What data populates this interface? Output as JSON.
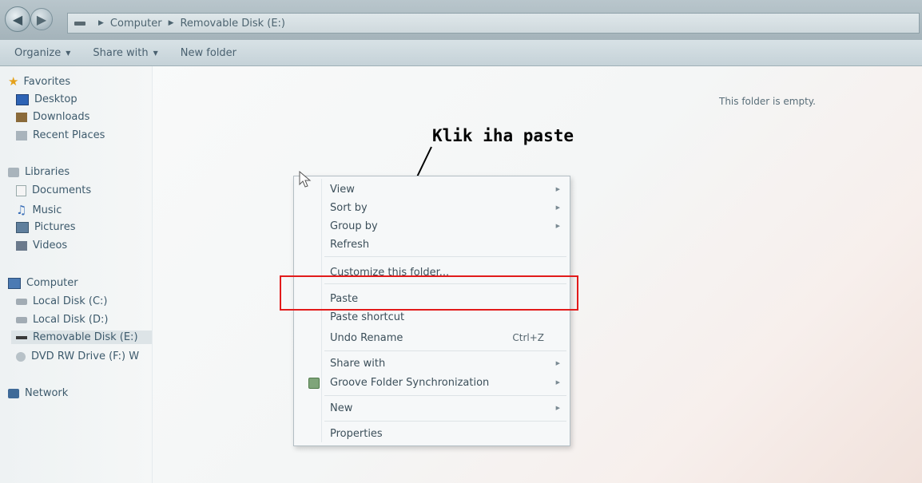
{
  "address_bar": {
    "breadcrumb": [
      "Computer",
      "Removable Disk (E:)"
    ]
  },
  "toolbar": {
    "organize_label": "Organize",
    "share_with_label": "Share with",
    "new_folder_label": "New folder"
  },
  "nav_pane": {
    "items": [
      {
        "label": "Favorites",
        "icon": "star-icon"
      },
      {
        "label": "Desktop",
        "icon": "desktop-icon"
      },
      {
        "label": "Downloads",
        "icon": "downloads-icon"
      },
      {
        "label": "Recent Places",
        "icon": "recent-places-icon"
      },
      {
        "label": "Libraries",
        "icon": "libraries-icon"
      },
      {
        "label": "Documents",
        "icon": "documents-icon"
      },
      {
        "label": "Music",
        "icon": "music-icon"
      },
      {
        "label": "Pictures",
        "icon": "pictures-icon"
      },
      {
        "label": "Videos",
        "icon": "videos-icon"
      },
      {
        "label": "Computer",
        "icon": "computer-icon"
      },
      {
        "label": "Local Disk (C:)",
        "icon": "disk-icon"
      },
      {
        "label": "Local Disk (D:)",
        "icon": "disk-icon"
      },
      {
        "label": "Removable Disk (E:)",
        "icon": "removable-disk-icon",
        "selected": true
      },
      {
        "label": "DVD RW Drive (F:) W",
        "icon": "dvd-drive-icon"
      },
      {
        "label": "Network",
        "icon": "network-icon"
      }
    ]
  },
  "content": {
    "empty_message": "This folder is empty."
  },
  "annotation": {
    "text": "Klik iha paste",
    "highlight_color": "#e21b1b"
  },
  "context_menu": {
    "items": [
      {
        "label": "View",
        "submenu": true
      },
      {
        "label": "Sort by",
        "submenu": true
      },
      {
        "label": "Group by",
        "submenu": true
      },
      {
        "label": "Refresh"
      },
      {
        "label": "Customize this folder..."
      },
      {
        "label": "Paste"
      },
      {
        "label": "Paste shortcut"
      },
      {
        "label": "Undo Rename",
        "shortcut": "Ctrl+Z"
      },
      {
        "label": "Share with",
        "submenu": true
      },
      {
        "label": "Groove Folder Synchronization",
        "submenu": true,
        "icon": "groove-icon"
      },
      {
        "label": "New",
        "submenu": true
      },
      {
        "label": "Properties"
      }
    ]
  }
}
